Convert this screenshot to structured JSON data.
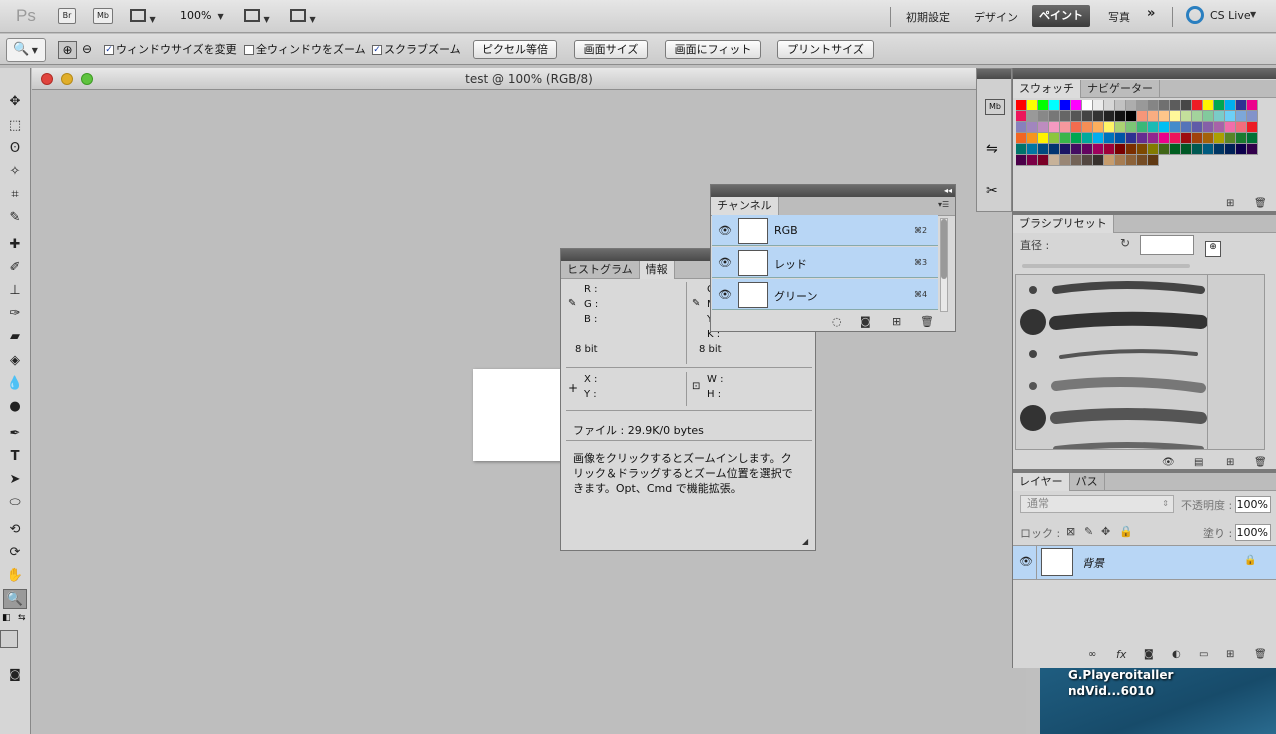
{
  "appbar": {
    "logo": "Ps",
    "bridge_label": "Br",
    "minibridge_label": "Mb",
    "zoom": "100%",
    "workspaces": [
      "初期設定",
      "デザイン",
      "ペイント",
      "写真"
    ],
    "more": "»",
    "cslive": "CS Live"
  },
  "options": {
    "resize_windows": "ウィンドウサイズを変更",
    "zoom_all": "全ウィンドウをズーム",
    "scrubby": "スクラブズーム",
    "actual_pixels": "ピクセル等倍",
    "screen_size": "画面サイズ",
    "fit_screen": "画面にフィット",
    "print_size": "プリントサイズ",
    "checks": {
      "resize": true,
      "zoom_all": false,
      "scrubby": true
    }
  },
  "document": {
    "title": "test @ 100% (RGB/8)"
  },
  "info_panel": {
    "tabs": [
      "ヒストグラム",
      "情報"
    ],
    "labels_rgb": [
      "R :",
      "G :",
      "B :"
    ],
    "labels_cmyk": [
      "C",
      "M",
      "Y",
      "K :"
    ],
    "bitdepth_left": "8 bit",
    "bitdepth_right": "8 bit",
    "xy": [
      "X :",
      "Y :"
    ],
    "wh": [
      "W :",
      "H :"
    ],
    "file": "ファイル : 29.9K/0 bytes",
    "hint": "画像をクリックするとズームインします。クリック＆ドラッグするとズーム位置を選択できます。Opt、Cmd で機能拡張。"
  },
  "channels_panel": {
    "tab": "チャンネル",
    "rows": [
      {
        "name": "RGB",
        "shortcut": "⌘2"
      },
      {
        "name": "レッド",
        "shortcut": "⌘3"
      },
      {
        "name": "グリーン",
        "shortcut": "⌘4"
      }
    ]
  },
  "swatches_panel": {
    "tabs": [
      "スウォッチ",
      "ナビゲーター"
    ]
  },
  "brush_panel": {
    "tab": "ブラシプリセット",
    "diameter_label": "直径 :"
  },
  "layers_panel": {
    "tabs": [
      "レイヤー",
      "パス"
    ],
    "blend_mode": "通常",
    "opacity_label": "不透明度 :",
    "opacity": "100%",
    "lock_label": "ロック :",
    "fill_label": "塗り :",
    "fill": "100%",
    "layer_name": "背景"
  },
  "desktop": {
    "line1": "G.Playeroitaller",
    "line2": "ndVid...6010"
  },
  "colors": {
    "selection": "#b8d6f5",
    "active_workspace": "#4a4a4a"
  }
}
